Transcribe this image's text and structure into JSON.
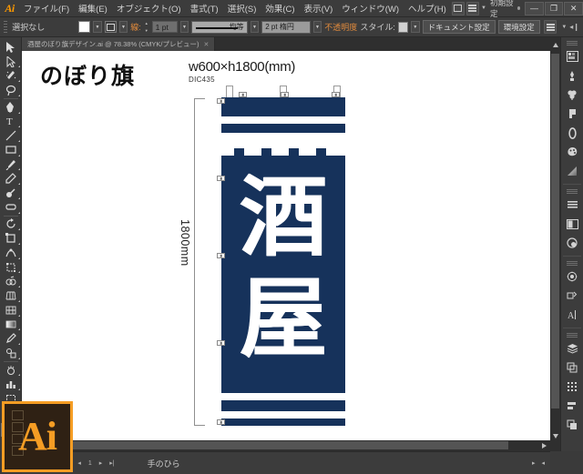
{
  "app": {
    "logo": "Ai",
    "workspace": "初期設定"
  },
  "menubar": {
    "items": [
      {
        "label": "ファイル(F)"
      },
      {
        "label": "編集(E)"
      },
      {
        "label": "オブジェクト(O)"
      },
      {
        "label": "書式(T)"
      },
      {
        "label": "選択(S)"
      },
      {
        "label": "効果(C)"
      },
      {
        "label": "表示(V)"
      },
      {
        "label": "ウィンドウ(W)"
      },
      {
        "label": "ヘルプ(H)"
      }
    ],
    "bridge_icon": "bridge-icon",
    "arrange_icon": "arrange-documents-icon",
    "window_buttons": {
      "minimize": "—",
      "maximize": "❐",
      "close": "✕"
    }
  },
  "controlbar": {
    "selection_status": "選択なし",
    "fill_label": "fill-swatch",
    "stroke_label": "stroke-swatch",
    "stroke_text": "線:",
    "stroke_weight": "1 pt",
    "stroke_profile": "均等",
    "brush_def": "2 pt 楕円",
    "opacity_label": "不透明度",
    "style_label": "スタイル:",
    "document_setup": "ドキュメント設定",
    "preferences": "環境設定"
  },
  "document": {
    "tab_title": "酒屋のぼり旗デザイン.ai @ 78.38% (CMYK/プレビュー)",
    "close_glyph": "✕"
  },
  "toolbar": {
    "tools": [
      {
        "name": "selection-tool",
        "glyph": "arrow"
      },
      {
        "name": "direct-selection-tool",
        "glyph": "arrow-white"
      },
      {
        "name": "magic-wand-tool",
        "glyph": "wand"
      },
      {
        "name": "lasso-tool",
        "glyph": "lasso"
      },
      {
        "name": "pen-tool",
        "glyph": "pen"
      },
      {
        "name": "type-tool",
        "glyph": "T"
      },
      {
        "name": "line-segment-tool",
        "glyph": "line"
      },
      {
        "name": "rectangle-tool",
        "glyph": "rect"
      },
      {
        "name": "paintbrush-tool",
        "glyph": "brush"
      },
      {
        "name": "pencil-tool",
        "glyph": "pencil"
      },
      {
        "name": "blob-brush-tool",
        "glyph": "blob"
      },
      {
        "name": "eraser-tool",
        "glyph": "eraser"
      },
      {
        "name": "rotate-tool",
        "glyph": "rotate"
      },
      {
        "name": "scale-tool",
        "glyph": "scale"
      },
      {
        "name": "width-tool",
        "glyph": "warp"
      },
      {
        "name": "free-transform-tool",
        "glyph": "transform"
      },
      {
        "name": "shape-builder-tool",
        "glyph": "shapebuilder"
      },
      {
        "name": "perspective-grid-tool",
        "glyph": "perspective"
      },
      {
        "name": "mesh-tool",
        "glyph": "mesh"
      },
      {
        "name": "gradient-tool",
        "glyph": "gradient"
      },
      {
        "name": "eyedropper-tool",
        "glyph": "eyedropper"
      },
      {
        "name": "blend-tool",
        "glyph": "blend"
      },
      {
        "name": "symbol-sprayer-tool",
        "glyph": "symbol"
      },
      {
        "name": "column-graph-tool",
        "glyph": "graph"
      },
      {
        "name": "artboard-tool",
        "glyph": "artboard"
      },
      {
        "name": "slice-tool",
        "glyph": "slice"
      },
      {
        "name": "hand-tool",
        "glyph": "hand",
        "active": true
      },
      {
        "name": "zoom-tool",
        "glyph": "zoom"
      }
    ]
  },
  "right_panels": {
    "icons": [
      {
        "name": "color-panel-icon"
      },
      {
        "name": "color-guide-panel-icon"
      },
      {
        "name": "brushes-panel-icon"
      },
      {
        "name": "symbols-panel-icon"
      },
      {
        "name": "stroke-panel-icon"
      },
      {
        "name": "swatches-panel-icon"
      },
      {
        "name": "gradient-panel-icon"
      },
      {
        "name": "align-panel-icon"
      },
      {
        "name": "transparency-panel-icon"
      },
      {
        "name": "appearance-panel-icon"
      },
      {
        "name": "graphic-styles-panel-icon"
      },
      {
        "name": "transform-panel-icon"
      },
      {
        "name": "character-panel-icon"
      },
      {
        "name": "layers-panel-icon"
      },
      {
        "name": "artboards-panel-icon"
      },
      {
        "name": "separation-preview-icon"
      },
      {
        "name": "align-objects-icon"
      },
      {
        "name": "pathfinder-panel-icon"
      }
    ]
  },
  "artwork": {
    "title": "のぼり旗",
    "size_label": "w600×h1800(mm)",
    "color_code": "DIC435",
    "banner_text_top": "酒",
    "banner_text_bottom": "屋",
    "height_dimension": "1800mm",
    "width_dimension": "600mm",
    "navy_color": "#16325b",
    "white_color": "#ffffff"
  },
  "statusbar": {
    "zoom_level": "78.38%",
    "current_tool": "手のひら"
  }
}
